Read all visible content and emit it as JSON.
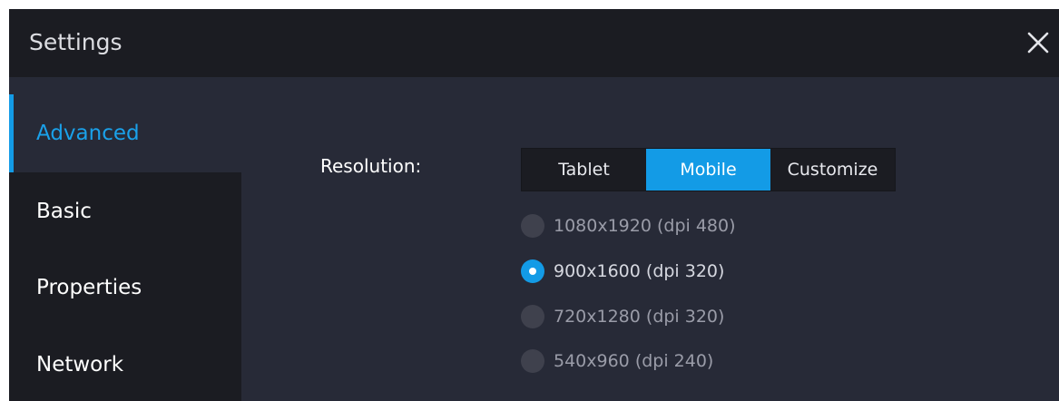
{
  "window": {
    "title": "Settings"
  },
  "sidebar": {
    "items": [
      {
        "label": "Advanced",
        "active": true
      },
      {
        "label": "Basic",
        "active": false
      },
      {
        "label": "Properties",
        "active": false
      },
      {
        "label": "Network",
        "active": false
      }
    ]
  },
  "resolution": {
    "label": "Resolution:",
    "tabs": [
      {
        "label": "Tablet",
        "active": false
      },
      {
        "label": "Mobile",
        "active": true
      },
      {
        "label": "Customize",
        "active": false
      }
    ],
    "options": [
      {
        "label": "1080x1920  (dpi 480)",
        "checked": false
      },
      {
        "label": "900x1600  (dpi 320)",
        "checked": true
      },
      {
        "label": "720x1280  (dpi 320)",
        "checked": false
      },
      {
        "label": "540x960  (dpi 240)",
        "checked": false
      }
    ]
  },
  "colors": {
    "accent": "#139be6",
    "titlebar": "#1b1c22",
    "panel": "#272a37"
  },
  "icons": {
    "close": "close-icon"
  }
}
